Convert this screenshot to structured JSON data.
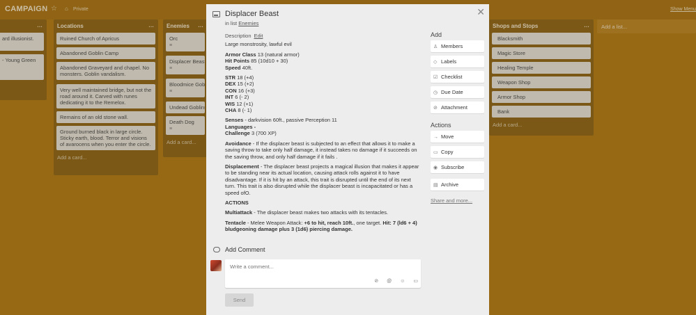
{
  "board": {
    "title": "CAMPAIGN",
    "star": "☆",
    "privacy": "Private",
    "show_menu": "Show Menu",
    "add_list": "Add a list..."
  },
  "lists": {
    "first": {
      "cards": [
        "ard illusionist.",
        "- Young Green"
      ],
      "add_card": ""
    },
    "locations": {
      "title": "Locations",
      "cards": [
        "Ruined Church of Apricus",
        "Abandoned Goblin Camp",
        "Abandoned Graveyard and chapel. No monsters. Goblin vandalism.",
        "Very well maintained bridge, but not the road around it. Carved with runes dedicating it to the Remelox.",
        "Remains of an old stone wall.",
        "Ground burned black in large circle. Sticky earth, blood. Terror and visions of avarocens when you enter the circle."
      ],
      "add_card": "Add a card..."
    },
    "enemies": {
      "title": "Enemies",
      "cards": [
        "Orc",
        "Displacer Beast",
        "Bloodmice Goblins",
        "Undead Goblins",
        "Death Dog"
      ],
      "add_card": "Add a card..."
    },
    "shops": {
      "title": "Shops and Stops",
      "cards": [
        "Blacksmith",
        "Magic Store",
        "Healing Temple",
        "Weapon Shop",
        "Armor Shop",
        "Bank"
      ],
      "add_card": "Add a card..."
    }
  },
  "modal": {
    "title": "Displacer Beast",
    "in_list_prefix": "in list",
    "in_list": "Enemies",
    "description_label": "Description",
    "edit_label": "Edit",
    "type_line": "Large monstrosity, lawful evil",
    "ac_label": "Armor Class",
    "ac_value": "13 (natural armor)",
    "hp_label": "Hit Points",
    "hp_value": "85 (10d10 + 30)",
    "speed_label": "Speed",
    "speed_value": "40ft.",
    "str_label": "STR",
    "str_value": "18 (+4)",
    "dex_label": "DEX",
    "dex_value": "15 (+2)",
    "con_label": "CON",
    "con_value": "16 (+3)",
    "int_label": "INT",
    "int_value": "6 (- 2)",
    "wis_label": "WIS",
    "wis_value": "12 (+1)",
    "cha_label": "CHA",
    "cha_value": "8 (- 1)",
    "senses_label": "Senses",
    "senses_value": "- darkvision 60ft., passive Perception 11",
    "languages_label": "Languages -",
    "challenge_label": "Challenge",
    "challenge_value": "3 (700 XP)",
    "avoidance_label": "Avoidance",
    "avoidance_text": " - If the displacer beast is subjected to an effect that allows it to make a saving throw to take only half damage, it instead takes no damage if it succeeds on the saving throw, and only half damage if it fails .",
    "displacement_label": "Displacement",
    "displacement_text": " - The displacer beast projects a magical illusion that makes it appear to be standing near its actual location, causing attack rolls against it to have disadvantage. If it is hit by an attack, this trait is disrupted until the end of its next turn. This trait is also disrupted while the displacer beast is incapacitated or has a speed ofO.",
    "actions_heading": "ACTIONS",
    "multiattack_label": "Multiattack",
    "multiattack_text": " - The displacer beast makes two attacks with its tentacles.",
    "tentacle_label": "Tentacle",
    "tentacle_text": " - Melee Weapon Attack: ",
    "tentacle_bold": "+6 to hit, reach 10ft.",
    "tentacle_text2": ", one target. ",
    "tentacle_bold2": "Hit: 7 (ld6 + 4) bludgeoning damage plus 3 (1d6) piercing damage.",
    "add_comment": "Add Comment",
    "comment_placeholder": "Write a comment...",
    "send": "Send"
  },
  "sidebar": {
    "add_heading": "Add",
    "add_buttons": [
      "Members",
      "Labels",
      "Checklist",
      "Due Date",
      "Attachment"
    ],
    "actions_heading": "Actions",
    "action_buttons": [
      "Move",
      "Copy",
      "Subscribe",
      "Archive"
    ],
    "share": "Share and more..."
  }
}
